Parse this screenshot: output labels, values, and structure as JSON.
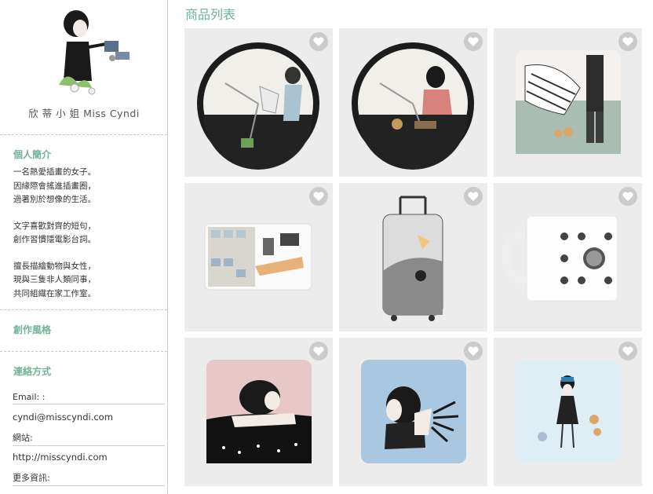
{
  "sidebar": {
    "author_name": "欣 蒂 小 姐 Miss Cyndi",
    "intro_title": "個人簡介",
    "bio": [
      [
        "一名熱愛插畫的女子。",
        "因緣際會搖進插畫圈，",
        "過著別於想像的生活。"
      ],
      [
        "文字喜歡對齊的短句，",
        "創作習慣隱電影台詞。"
      ],
      [
        "擅長描繪動物與女性，",
        "現與三隻非人類同事，",
        "共同組織在家工作室。"
      ]
    ],
    "style_title": "創作風格",
    "contact_title": "連絡方式",
    "email_label": "Email: :",
    "email_value": "cyndi@misscyndi.com",
    "website_label": "網站:",
    "website_value": "http://misscyndi.com",
    "more_label": "更多資訊:"
  },
  "main": {
    "title": "商品列表",
    "products": [
      {
        "kind": "clock",
        "icon": "clock-cat-artwork"
      },
      {
        "kind": "clock",
        "icon": "clock-girl-artwork"
      },
      {
        "kind": "pillow",
        "icon": "pillow-dancers-artwork"
      },
      {
        "kind": "card",
        "icon": "card-studio-artwork"
      },
      {
        "kind": "luggage",
        "icon": "luggage-fish-artwork"
      },
      {
        "kind": "mug",
        "icon": "mug-icons-artwork"
      },
      {
        "kind": "pillow",
        "icon": "pillow-sleeping-couple-artwork"
      },
      {
        "kind": "pillow",
        "icon": "pillow-kiss-artwork"
      },
      {
        "kind": "pillow",
        "icon": "pillow-girl-dogs-artwork"
      }
    ]
  },
  "colors": {
    "accent": "#6fb397",
    "heart_bg": "#c8c8c8"
  }
}
